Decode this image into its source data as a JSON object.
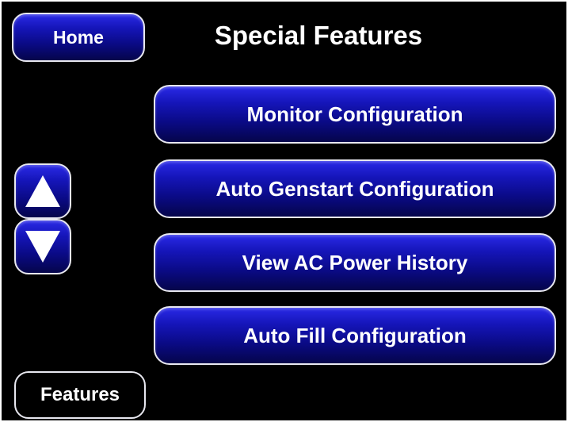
{
  "header": {
    "home_label": "Home",
    "title": "Special Features"
  },
  "menu": {
    "items": [
      {
        "label": "Monitor Configuration"
      },
      {
        "label": "Auto Genstart Configuration"
      },
      {
        "label": "View AC Power History"
      },
      {
        "label": "Auto Fill Configuration"
      }
    ]
  },
  "scroll": {
    "up_icon": "triangle-up-icon",
    "down_icon": "triangle-down-icon"
  },
  "footer": {
    "features_label": "Features"
  },
  "colors": {
    "background": "#000000",
    "button_top": "#2a2ae6",
    "button_bottom": "#05054a",
    "button_border": "#e8e8f0",
    "text": "#ffffff"
  }
}
